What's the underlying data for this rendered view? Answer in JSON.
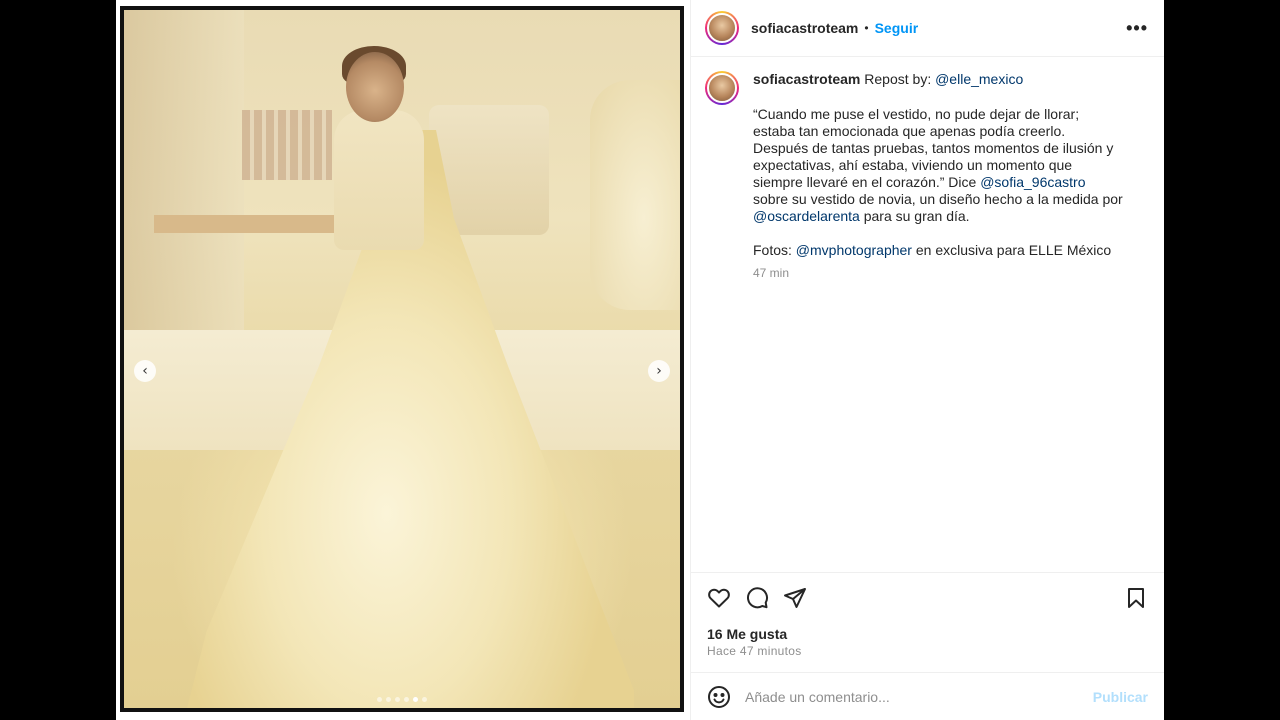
{
  "post": {
    "username": "sofiacastroteam",
    "separator": "•",
    "follow_label": "Seguir",
    "more_label": "•••"
  },
  "caption": {
    "username": "sofiacastroteam",
    "repost_prefix": " Repost by: ",
    "repost_handle": "@elle_mexico",
    "text_part1": "“Cuando me puse el vestido, no pude dejar de llorar; estaba tan emocionada que apenas podía creerlo. Después de tantas pruebas, tantos momentos de ilusión y expectativas, ahí estaba, viviendo un momento que siempre llevaré en el corazón.” Dice ",
    "mention1": "@sofia_96castro",
    "text_part2": " sobre su vestido de novia, un diseño hecho a la medida por ",
    "mention2": "@oscardelarenta",
    "text_part3": " para su gran día.",
    "photos_prefix": "Fotos: ",
    "photos_handle": "@mvphotographer",
    "photos_suffix": " en exclusiva para ELLE México",
    "time": "47 min"
  },
  "carousel": {
    "prev_label": "‹",
    "next_label": "›",
    "slides": 6,
    "active_slide": 4
  },
  "actions": {
    "likes": "16 Me gusta",
    "ago": "Hace 47 minutos",
    "icons": [
      "heart-icon",
      "comment-icon",
      "share-icon",
      "bookmark-icon"
    ]
  },
  "composer": {
    "placeholder": "Añade un comentario...",
    "publish_label": "Publicar"
  },
  "colors": {
    "link": "#00376b",
    "follow": "#0095f6",
    "publish_disabled": "#b2dffc",
    "muted": "#8e8e8e"
  }
}
